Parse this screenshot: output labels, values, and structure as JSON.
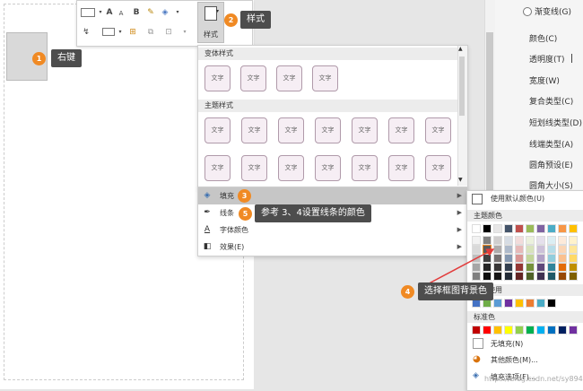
{
  "right_panel": {
    "items": [
      "渐变线(G)",
      "颜色(C)",
      "透明度(T)",
      "宽度(W)",
      "复合类型(C)",
      "短划线类型(D)",
      "线端类型(A)",
      "圆角预设(E)",
      "圆角大小(S)"
    ]
  },
  "toolbar": {
    "style_label": "样式",
    "font_a_big": "A",
    "font_a_small": "A",
    "bold": "B"
  },
  "gallery": {
    "section1_title": "变体样式",
    "section2_title": "主题样式",
    "swatch_text": "文字",
    "variant_count": 4,
    "theme_rows": 2,
    "theme_cols": 7
  },
  "context_menu": {
    "items": [
      {
        "label": "填充",
        "icon": "fill-bucket-icon",
        "highlighted": true
      },
      {
        "label": "线条",
        "icon": "pen-icon",
        "highlighted": false
      },
      {
        "label": "字体颜色",
        "icon": "font-color-icon",
        "highlighted": false
      },
      {
        "label": "效果(E)",
        "icon": "effects-icon",
        "highlighted": false
      }
    ]
  },
  "color_menu": {
    "default_color": "使用默认颜色(U)",
    "theme_title": "主题颜色",
    "recent_title": "最近使用",
    "standard_title": "标准色",
    "no_fill": "无填充(N)",
    "more_colors": "其他颜色(M)...",
    "fill_options": "填充选项(F)...",
    "theme_top": [
      "#ffffff",
      "#000000",
      "#e7e6e6",
      "#44546a",
      "#c0504d",
      "#9bbb59",
      "#8064a2",
      "#4bacc6",
      "#f79646",
      "#ffc000"
    ],
    "theme_shades": [
      [
        "#f2f2f2",
        "#d9d9d9",
        "#bfbfbf",
        "#a6a6a6",
        "#808080"
      ],
      [
        "#7f7f7f",
        "#595959",
        "#404040",
        "#262626",
        "#0d0d0d"
      ],
      [
        "#d0cece",
        "#aeabab",
        "#767171",
        "#3a3838",
        "#171616"
      ],
      [
        "#d6dce4",
        "#adb9ca",
        "#8497b0",
        "#333f4f",
        "#222a35"
      ],
      [
        "#f2dcdb",
        "#e6b9b8",
        "#d99694",
        "#953734",
        "#632423"
      ],
      [
        "#ebf1dd",
        "#d7e3bc",
        "#c3d69b",
        "#76923c",
        "#4f6128"
      ],
      [
        "#e5e0ec",
        "#ccc1d9",
        "#b2a2c7",
        "#5f497a",
        "#3f3151"
      ],
      [
        "#dbeef3",
        "#b7dde8",
        "#92cddc",
        "#31859b",
        "#205867"
      ],
      [
        "#fdeada",
        "#fbd5b5",
        "#fac08f",
        "#e36c09",
        "#974806"
      ],
      [
        "#fff2cc",
        "#ffe699",
        "#ffd966",
        "#bf8f00",
        "#7f6000"
      ]
    ],
    "recent": [
      "#4472c4",
      "#70ad47",
      "#5b9bd5",
      "#7030a0",
      "#ffc000",
      "#ed7d31",
      "#4bacc6",
      "#000000"
    ],
    "standard": [
      "#c00000",
      "#ff0000",
      "#ffc000",
      "#ffff00",
      "#92d050",
      "#00b050",
      "#00b0f0",
      "#0070c0",
      "#002060",
      "#7030a0"
    ]
  },
  "callouts": {
    "c1": {
      "num": "1",
      "text": "右键"
    },
    "c2": {
      "num": "2",
      "text": "样式"
    },
    "c3": {
      "num": "3"
    },
    "c5": {
      "num": "5",
      "text": "参考 3、4设置线条的颜色"
    },
    "c4": {
      "num": "4",
      "text": "选择框图背景色"
    }
  },
  "watermark": "https://blog.csdn.net/sy8945",
  "colors": {
    "accent_badge": "#f08a24",
    "tip_bg": "#4d4d4d",
    "arrow": "#e23b3b"
  }
}
